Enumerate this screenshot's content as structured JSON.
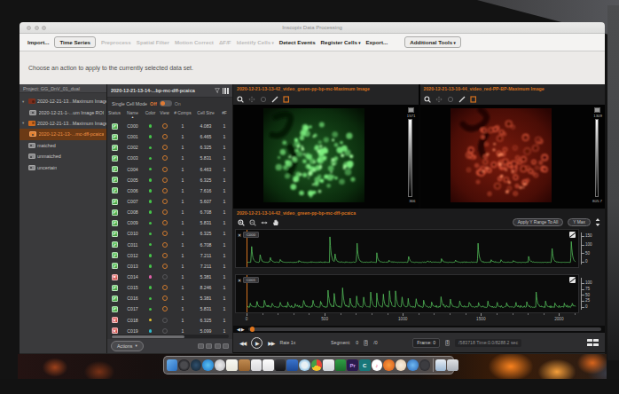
{
  "window": {
    "title": "Inscopix Data Processing"
  },
  "toolbar": {
    "items": [
      {
        "label": "Import...",
        "style": "plain"
      },
      {
        "label": "Time Series",
        "style": "boxed"
      },
      {
        "label": "Preprocess",
        "style": "disabled"
      },
      {
        "label": "Spatial Filter",
        "style": "disabled"
      },
      {
        "label": "Motion Correct",
        "style": "disabled"
      },
      {
        "label": "ΔF/F",
        "style": "disabled"
      },
      {
        "label": "Identify Cells",
        "style": "disabled",
        "arrow": true
      },
      {
        "label": "Detect Events",
        "style": "plain"
      },
      {
        "label": "Register Cells",
        "style": "plain",
        "arrow": true
      },
      {
        "label": "Export...",
        "style": "plain"
      },
      {
        "label": "Additional Tools",
        "style": "boxed",
        "arrow": true,
        "gap": true
      }
    ]
  },
  "message_bar": {
    "text": "Choose an action to apply to the currently selected data set."
  },
  "project_panel": {
    "header": "Project:  GG_DnV_01_dual",
    "items": [
      {
        "label": "2020-12-21-13...Maximum Image",
        "icon": "movie",
        "icon_color": "#7c2f1d",
        "caret": true,
        "indent": 0
      },
      {
        "label": "2020-12-21-1-...um Image ROI",
        "icon": "img",
        "indent": 1
      },
      {
        "label": "2020-12-21-13...Maximum Image",
        "icon": "movie",
        "icon_color": "#d06a1e",
        "caret": true,
        "indent": 0
      },
      {
        "label": "2020-12-21-13-...mc-dff-pcaica",
        "icon": "img",
        "indent": 1,
        "selected": true
      },
      {
        "label": "matched",
        "icon": "img",
        "indent": 0
      },
      {
        "label": "unmatched",
        "icon": "img",
        "indent": 0
      },
      {
        "label": "uncertain",
        "icon": "img",
        "indent": 0
      }
    ]
  },
  "cell_table": {
    "title": "2020-12-21-13-14-...bp-mc-dff-pcaica",
    "mode_label": "Single Cell Mode",
    "off_label": "Off",
    "on_label": "On",
    "columns": [
      "Status",
      "Name",
      "Color",
      "View",
      "# Comps",
      "Cell Size",
      "#F"
    ],
    "sort_column": "Name",
    "actions_label": "Actions",
    "rows": [
      {
        "name": "C000",
        "status": "accepted",
        "color": "#46c24a",
        "view": "on",
        "comps": "1",
        "size": "4.083",
        "extra": "1"
      },
      {
        "name": "C001",
        "status": "accepted",
        "color": "#46c24a",
        "view": "on",
        "comps": "1",
        "size": "6.465",
        "extra": "1"
      },
      {
        "name": "C002",
        "status": "accepted",
        "color": "#46c24a",
        "view": "on",
        "comps": "1",
        "size": "6.325",
        "extra": "1"
      },
      {
        "name": "C003",
        "status": "accepted",
        "color": "#46c24a",
        "view": "on",
        "comps": "1",
        "size": "5.831",
        "extra": "1"
      },
      {
        "name": "C004",
        "status": "accepted",
        "color": "#46c24a",
        "view": "on",
        "comps": "1",
        "size": "6.463",
        "extra": "1"
      },
      {
        "name": "C005",
        "status": "accepted",
        "color": "#46c24a",
        "view": "on",
        "comps": "1",
        "size": "6.325",
        "extra": "1"
      },
      {
        "name": "C006",
        "status": "accepted",
        "color": "#46c24a",
        "view": "on",
        "comps": "1",
        "size": "7.616",
        "extra": "1"
      },
      {
        "name": "C007",
        "status": "accepted",
        "color": "#46c24a",
        "view": "on",
        "comps": "1",
        "size": "5.607",
        "extra": "1"
      },
      {
        "name": "C008",
        "status": "accepted",
        "color": "#46c24a",
        "view": "on",
        "comps": "1",
        "size": "6.708",
        "extra": "1"
      },
      {
        "name": "C009",
        "status": "accepted",
        "color": "#46c24a",
        "view": "on",
        "comps": "1",
        "size": "5.831",
        "extra": "1"
      },
      {
        "name": "C010",
        "status": "accepted",
        "color": "#46c24a",
        "view": "on",
        "comps": "1",
        "size": "6.325",
        "extra": "1"
      },
      {
        "name": "C011",
        "status": "accepted",
        "color": "#46c24a",
        "view": "on",
        "comps": "1",
        "size": "6.708",
        "extra": "1"
      },
      {
        "name": "C012",
        "status": "accepted",
        "color": "#46c24a",
        "view": "on",
        "comps": "1",
        "size": "7.211",
        "extra": "1"
      },
      {
        "name": "C013",
        "status": "accepted",
        "color": "#46c24a",
        "view": "on",
        "comps": "1",
        "size": "7.211",
        "extra": "1"
      },
      {
        "name": "C014",
        "status": "rejected",
        "color": "#e060a8",
        "view": "off",
        "comps": "1",
        "size": "5.381",
        "extra": "1"
      },
      {
        "name": "C015",
        "status": "accepted",
        "color": "#46c24a",
        "view": "on",
        "comps": "1",
        "size": "8.246",
        "extra": "1"
      },
      {
        "name": "C016",
        "status": "accepted",
        "color": "#46c24a",
        "view": "on",
        "comps": "1",
        "size": "5.381",
        "extra": "1"
      },
      {
        "name": "C017",
        "status": "accepted",
        "color": "#46c24a",
        "view": "on",
        "comps": "1",
        "size": "5.831",
        "extra": "1"
      },
      {
        "name": "C018",
        "status": "rejected",
        "color": "#e0c030",
        "view": "off",
        "comps": "1",
        "size": "6.325",
        "extra": "1"
      },
      {
        "name": "C019",
        "status": "rejected",
        "color": "#30b8c8",
        "view": "off",
        "comps": "1",
        "size": "5.099",
        "extra": "1"
      }
    ]
  },
  "viewers": {
    "green": {
      "title": "2020-12-21-13-13-42_video_green-pp-bp-mc-Maximum Image",
      "cb_max": "1571",
      "cb_min": "366"
    },
    "red": {
      "title": "2020-12-21-13-10-44_video_red-PP-BP-Maximum Image",
      "cb_max": "1309",
      "cb_min": "805.7"
    }
  },
  "trace_viewer": {
    "title": "2020-12-21-13-14-42_video_green-pp-bp-mc-dff-pcaica",
    "apply_button": "Apply Y Range To All",
    "ymax_button": "Y Max",
    "xticks": [
      0,
      500,
      1000,
      1500,
      2000
    ],
    "x_minor_step": 100,
    "x_max": 2100
  },
  "chart_data": [
    {
      "type": "line",
      "title": "C000 trace",
      "ylabel_ticks": [
        150,
        100,
        50,
        0
      ],
      "y_max": 155,
      "noise": 3,
      "series_color": "#52bb58",
      "spikes": [
        [
          25,
          118
        ],
        [
          80,
          52
        ],
        [
          145,
          36
        ],
        [
          210,
          16
        ],
        [
          330,
          10
        ],
        [
          528,
          148
        ],
        [
          560,
          50
        ],
        [
          700,
          140
        ],
        [
          828,
          56
        ],
        [
          905,
          14
        ],
        [
          1030,
          46
        ],
        [
          1150,
          12
        ],
        [
          1242,
          22
        ],
        [
          1330,
          16
        ],
        [
          1475,
          126
        ],
        [
          1560,
          14
        ],
        [
          1622,
          18
        ],
        [
          1700,
          12
        ],
        [
          1800,
          34
        ],
        [
          1948,
          104
        ],
        [
          2072,
          138
        ]
      ]
    },
    {
      "type": "line",
      "title": "C001 trace",
      "ylabel_ticks": [
        100,
        75,
        50,
        25,
        0
      ],
      "y_max": 110,
      "noise": 5,
      "series_color": "#52bb58",
      "spikes": [
        [
          18,
          16
        ],
        [
          60,
          24
        ],
        [
          108,
          30
        ],
        [
          158,
          20
        ],
        [
          208,
          26
        ],
        [
          258,
          18
        ],
        [
          305,
          16
        ],
        [
          358,
          38
        ],
        [
          418,
          34
        ],
        [
          468,
          26
        ],
        [
          515,
          82
        ],
        [
          555,
          58
        ],
        [
          608,
          92
        ],
        [
          655,
          44
        ],
        [
          698,
          48
        ],
        [
          742,
          52
        ],
        [
          788,
          72
        ],
        [
          828,
          58
        ],
        [
          868,
          62
        ],
        [
          908,
          78
        ],
        [
          948,
          68
        ],
        [
          988,
          52
        ],
        [
          1028,
          34
        ],
        [
          1078,
          44
        ],
        [
          1128,
          30
        ],
        [
          1178,
          26
        ],
        [
          1238,
          48
        ],
        [
          1298,
          38
        ],
        [
          1358,
          28
        ],
        [
          1418,
          24
        ],
        [
          1478,
          20
        ],
        [
          1538,
          26
        ],
        [
          1598,
          18
        ],
        [
          1658,
          16
        ],
        [
          1718,
          14
        ],
        [
          1788,
          22
        ],
        [
          1848,
          62
        ],
        [
          1908,
          24
        ],
        [
          1968,
          18
        ],
        [
          2028,
          16
        ],
        [
          2078,
          20
        ]
      ]
    }
  ],
  "trace_panels": [
    {
      "label": "C000",
      "chart": 0
    },
    {
      "label": "C001",
      "chart": 1
    }
  ],
  "playback": {
    "rate_label": "Rate 1x",
    "segment_label": "Segment:",
    "segment_value": "0",
    "segment_total": "/0",
    "frame_label": "Frame:",
    "frame_value": "0",
    "frame_total": "/583718",
    "time_text": "Time:0.0/8288.2 sec"
  },
  "dock": {
    "icons": [
      {
        "name": "finder",
        "shape": "sq",
        "color": "linear-gradient(135deg,#6ab0ee,#2a6fc0)"
      },
      {
        "name": "launchpad",
        "shape": "ci",
        "color": "radial-gradient(circle,#4a4a4e 40%,#232327 70%)"
      },
      {
        "name": "photos-dark",
        "shape": "ci",
        "color": "radial-gradient(circle,#30506e,#15232e)"
      },
      {
        "name": "safari",
        "shape": "ci",
        "color": "radial-gradient(circle,#5cc0f0,#1a72c8)"
      },
      {
        "name": "appstore",
        "shape": "ci",
        "color": "radial-gradient(circle,#eaeaea,#b9b9bd)"
      },
      {
        "name": "notes",
        "shape": "sq",
        "color": "linear-gradient(#f8f8f2,#e8e6da)"
      },
      {
        "name": "folder-tan",
        "shape": "sq",
        "color": "linear-gradient(#c08a50,#96622e)"
      },
      {
        "name": "mail",
        "shape": "sq",
        "color": "linear-gradient(#f4f4f6,#d8d8dc)"
      },
      {
        "name": "pages",
        "shape": "sq",
        "color": "linear-gradient(#fdfdfd,#e2e2e4)"
      },
      {
        "name": "terminal",
        "shape": "sq",
        "color": "linear-gradient(#3a3a3e,#151517)"
      },
      {
        "name": "files-blue",
        "shape": "sq",
        "color": "linear-gradient(#3a74cc,#1d4a96)"
      },
      {
        "name": "maps",
        "shape": "ci",
        "color": "radial-gradient(circle,#e8f0f4 35%,#4aa0dc)"
      },
      {
        "name": "chrome",
        "shape": "ci",
        "color": "conic-gradient(#e44437 0 33%,#f7c52a 33% 66%,#42a047 66% 100%)"
      },
      {
        "name": "preview",
        "shape": "sq",
        "color": "linear-gradient(#f2f2f4,#cfd4da)"
      },
      {
        "name": "play-green",
        "shape": "sq",
        "color": "linear-gradient(#2f9e44,#1b6e2c)"
      },
      {
        "name": "premiere",
        "shape": "sq",
        "color": "#2a1a4e",
        "glyph": "Pr",
        "glyph_color": "#cba3f5"
      },
      {
        "name": "c-app",
        "shape": "sq",
        "color": "#17777a",
        "glyph": "C",
        "glyph_color": "#ffffff"
      },
      {
        "name": "music",
        "shape": "ci",
        "color": "radial-gradient(circle,#ffffff 55%,#e8e8ec)",
        "glyph": "♪",
        "glyph_color": "#e5486a"
      },
      {
        "name": "firefox",
        "shape": "ci",
        "color": "radial-gradient(circle,#f89a3e,#d85a1a)"
      },
      {
        "name": "mission",
        "shape": "ci",
        "color": "radial-gradient(circle,#f6ede0,#e4c9a8)"
      },
      {
        "name": "safari-alt",
        "shape": "ci",
        "color": "radial-gradient(circle,#70b8f0,#2a68b8)"
      },
      {
        "name": "camera-dark",
        "shape": "ci",
        "color": "radial-gradient(circle,#3c3c40 45%,#1c1c20)"
      },
      {
        "name": "sep",
        "shape": "sep"
      },
      {
        "name": "downloads",
        "shape": "sq",
        "color": "linear-gradient(#e8eef4,#9cb8d4)"
      },
      {
        "name": "trash",
        "shape": "sq",
        "color": "linear-gradient(#dfe1e4,#aab0b8)"
      }
    ]
  }
}
